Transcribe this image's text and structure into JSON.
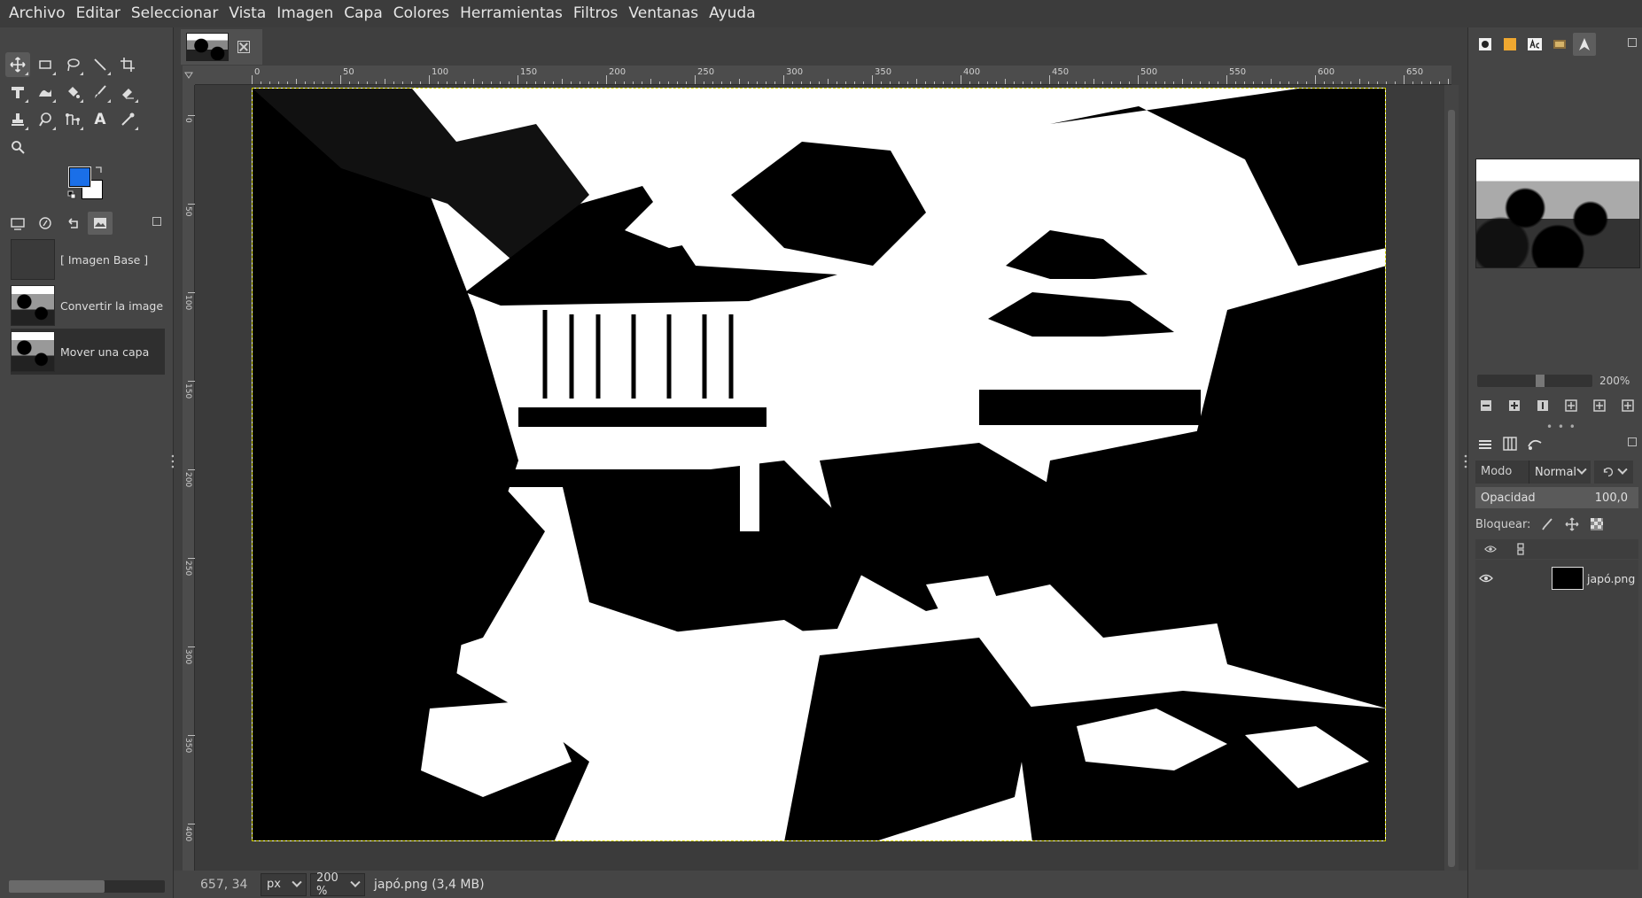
{
  "menu": [
    "Archivo",
    "Editar",
    "Seleccionar",
    "Vista",
    "Imagen",
    "Capa",
    "Colores",
    "Herramientas",
    "Filtros",
    "Ventanas",
    "Ayuda"
  ],
  "toolbox": {
    "tools": [
      "move-tool",
      "rect-select-tool",
      "free-select-tool",
      "fuzzy-select-tool",
      "crop-tool",
      "unified-transform-tool",
      "warp-transform-tool",
      "bucket-fill-tool",
      "paintbrush-tool",
      "eraser-tool",
      "clone-tool",
      "smudge-tool",
      "paths-tool",
      "text-tool",
      "color-picker-tool",
      "zoom-tool"
    ],
    "fg_color": "#1a6fe8",
    "bg_color": "#ffffff",
    "text_tool_label": "A"
  },
  "history": {
    "items": [
      {
        "label": "[ Imagen Base ]"
      },
      {
        "label": "Convertir la imagen a"
      },
      {
        "label": "Mover una capa"
      }
    ]
  },
  "ruler": {
    "ticks": [
      "0",
      "50",
      "100",
      "150",
      "200",
      "250",
      "300",
      "350",
      "400",
      "450",
      "500",
      "550",
      "600",
      "650"
    ],
    "vticks": [
      "0",
      "50",
      "100",
      "150",
      "200",
      "250",
      "300",
      "350",
      "400"
    ]
  },
  "status": {
    "coords": "657, 34",
    "unit": "px",
    "zoom": "200 %",
    "file_info": "japó.png (3,4 MB)"
  },
  "navigator": {
    "zoom": "200%"
  },
  "layers_panel": {
    "mode_label": "Modo",
    "mode_value": "Normal",
    "opacity_label": "Opacidad",
    "opacity_value": "100,0",
    "lock_label": "Bloquear:",
    "layers": [
      {
        "name": "japó.png",
        "visible": true
      }
    ]
  }
}
